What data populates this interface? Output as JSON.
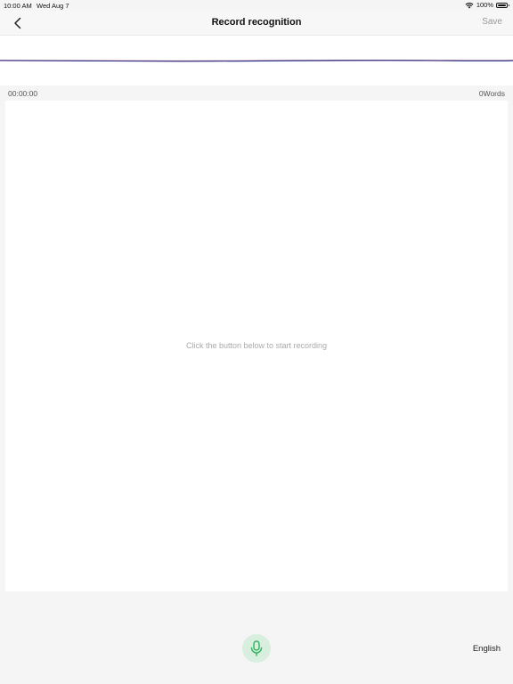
{
  "status_bar": {
    "time": "10:00 AM",
    "date": "Wed Aug 7",
    "battery": "100%",
    "battery_level": 1.0
  },
  "nav": {
    "title": "Record recognition",
    "save_label": "Save"
  },
  "recording": {
    "elapsed": "00:00:00",
    "word_count": "0Words"
  },
  "transcript": {
    "placeholder": "Click the button below to start recording"
  },
  "bottom": {
    "language": "English"
  },
  "icons": {
    "back": "chevron-left-icon",
    "mic": "microphone-icon",
    "wifi": "wifi-icon",
    "battery": "battery-icon"
  },
  "colors": {
    "accent": "#2fb35c",
    "mic_background": "#d8efe0",
    "waveform": "#2a2a8a"
  }
}
